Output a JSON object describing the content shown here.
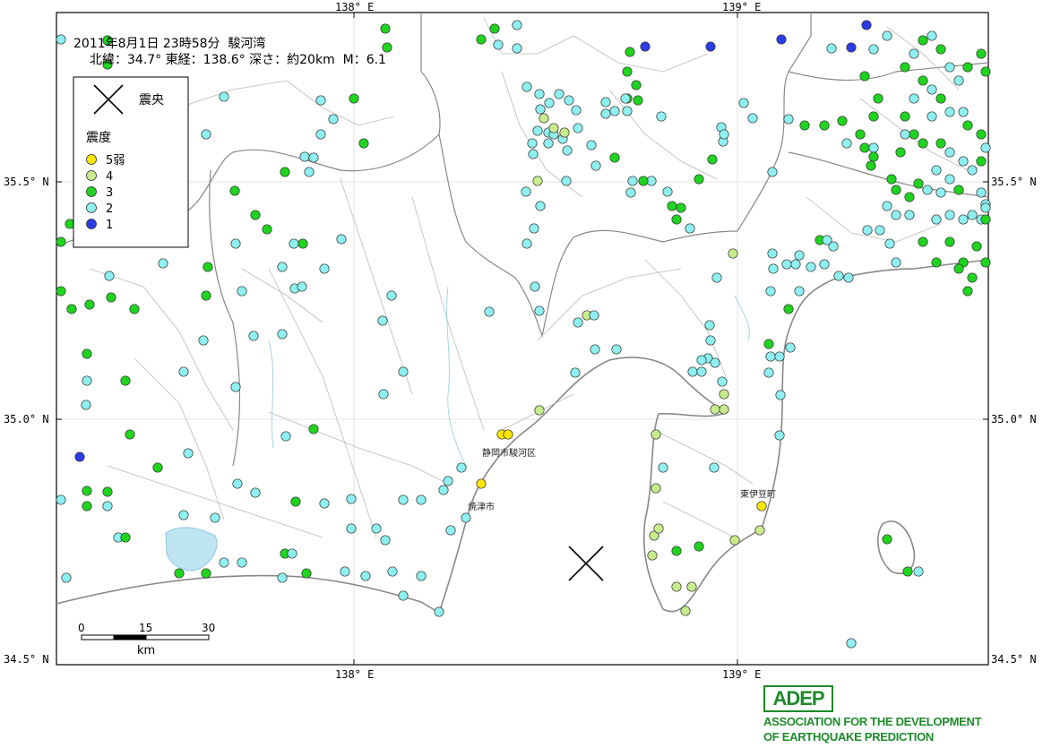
{
  "header": {
    "line1": "2011年8月1日 23時58分  駿河湾",
    "line2": "北緯：34.7° 東経：138.6° 深さ：約20km  M：6.1"
  },
  "legend": {
    "epicenter_label": "震央",
    "intensity_title": "震度",
    "items": [
      {
        "label": "5弱",
        "color": "#ffe600"
      },
      {
        "label": "4",
        "color": "#c8ec8c"
      },
      {
        "label": "3",
        "color": "#1ed41e"
      },
      {
        "label": "2",
        "color": "#8ef0f0"
      },
      {
        "label": "1",
        "color": "#2a3ce6"
      }
    ]
  },
  "axes": {
    "top_ticks": [
      "138° E",
      "139° E"
    ],
    "bottom_ticks": [
      "138° E",
      "139° E"
    ],
    "left_ticks": [
      "35.5° N",
      "35.0° N",
      "34.5° N"
    ],
    "right_ticks": [
      "35.5° N",
      "35.0° N",
      "34.5° N"
    ]
  },
  "scalebar": {
    "ticks": [
      "0",
      "15",
      "30"
    ],
    "unit": "km"
  },
  "places": [
    {
      "name": "静岡市駿河区"
    },
    {
      "name": "焼津市"
    },
    {
      "name": "東伊豆町"
    }
  ],
  "logo": {
    "acronym": "ADEP",
    "line1": "ASSOCIATION  FOR THE DEVELOPMENT",
    "line2": "OF EARTHQUAKE PREDICTION"
  }
}
